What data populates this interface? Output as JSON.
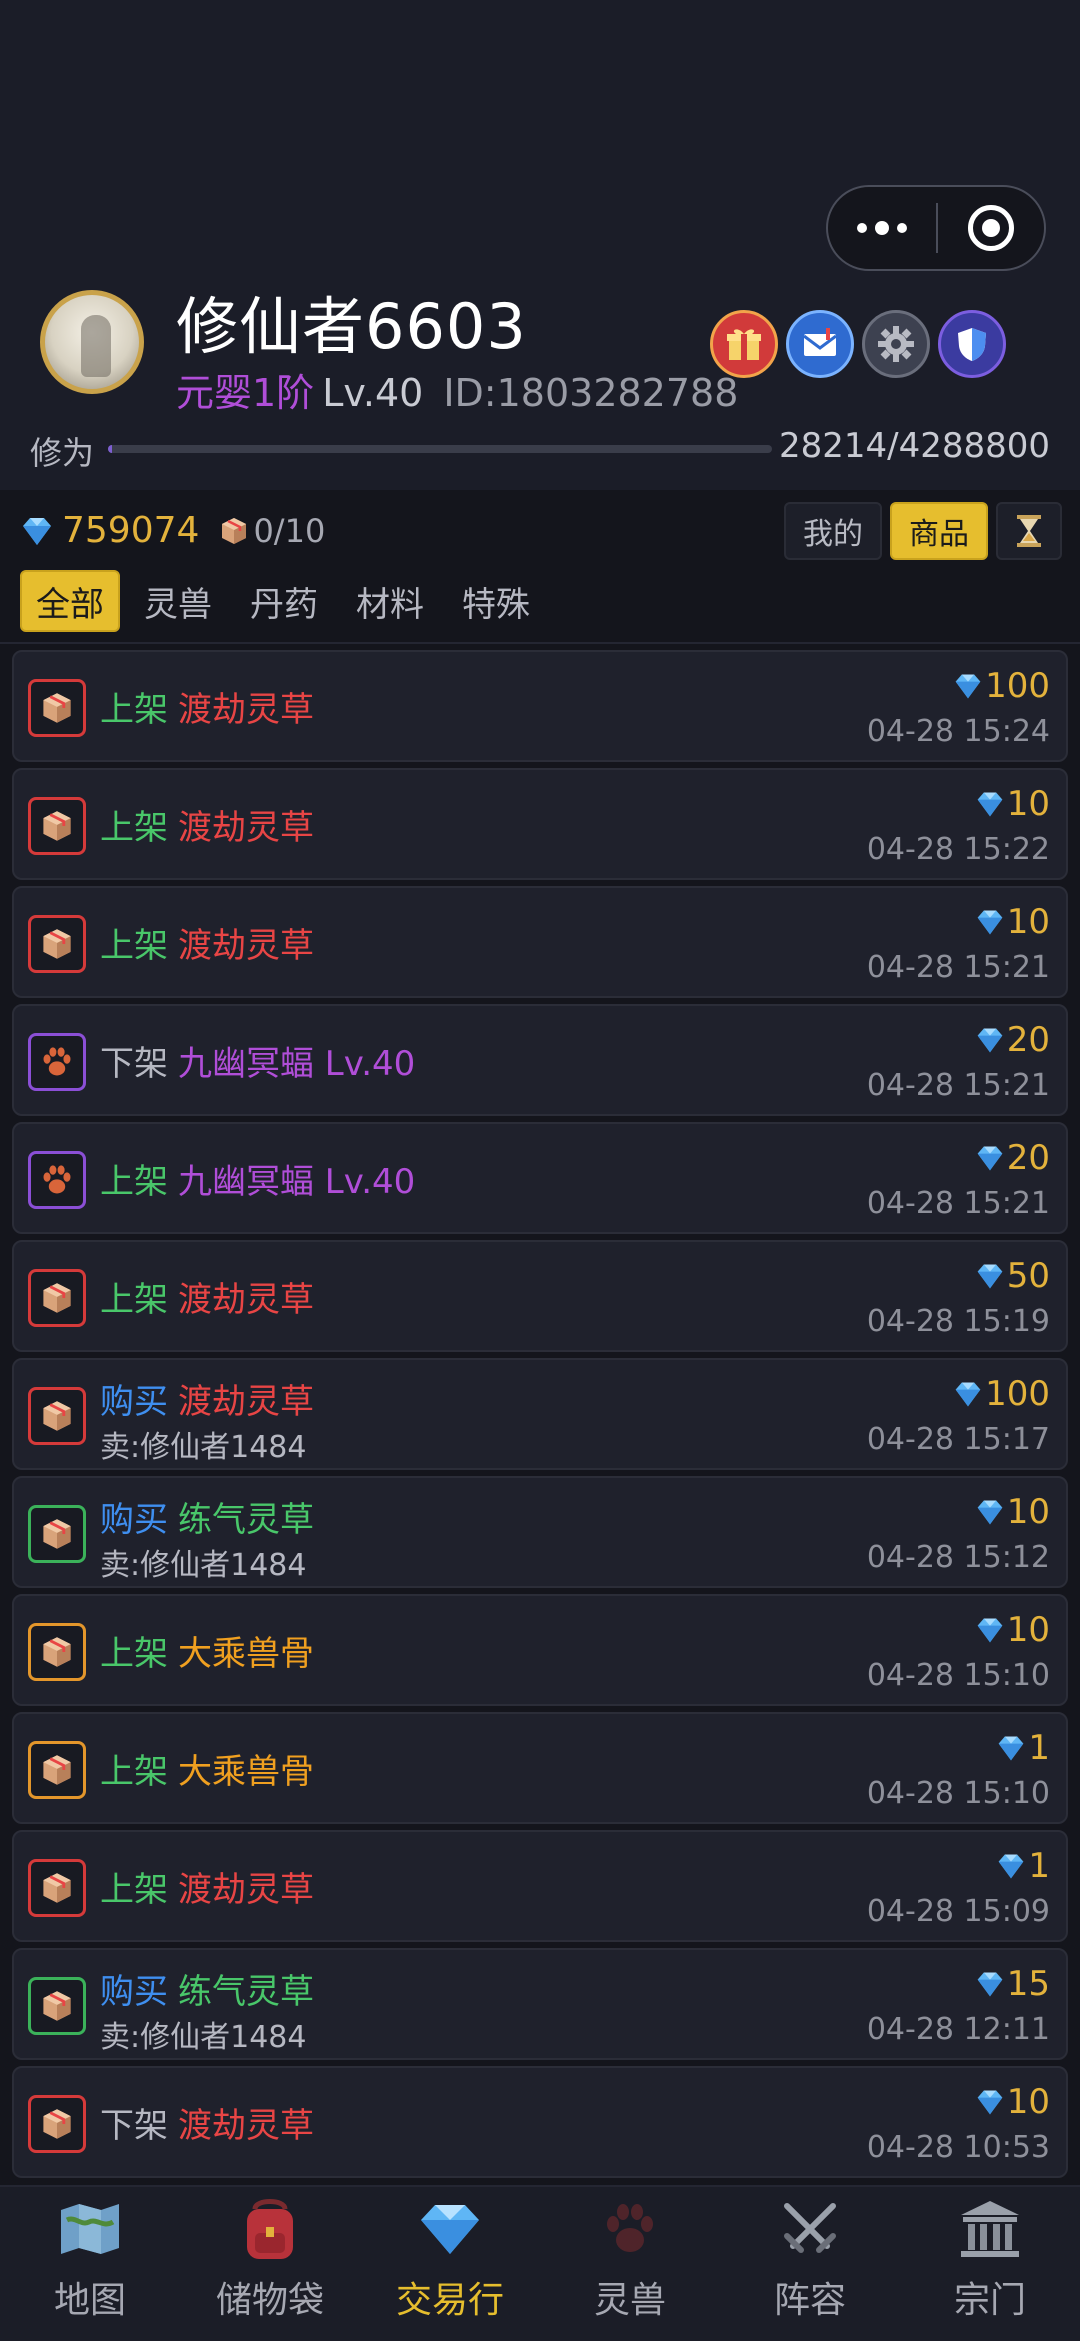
{
  "header": {
    "player_name": "修仙者6603",
    "realm": "元婴1阶",
    "level": "Lv.40",
    "player_id": "ID:1803282788",
    "cultivation_label": "修为",
    "cultivation_value": "28214/4288800",
    "cultivation_progress": 0.0066,
    "icons": [
      "gift-icon",
      "mail-icon",
      "gear-icon",
      "shield-icon"
    ]
  },
  "resources": {
    "gems": "759074",
    "capacity": "0/10"
  },
  "view_toggle": {
    "mine": "我的",
    "goods": "商品",
    "history_icon": "hourglass-icon"
  },
  "tabs": [
    "全部",
    "灵兽",
    "丹药",
    "材料",
    "特殊"
  ],
  "records": [
    {
      "action": "上架",
      "action_type": "up",
      "item": "渡劫灵草",
      "color": "red",
      "icon": "box-icon",
      "price": "100",
      "time": "04-28 15:24",
      "seller": ""
    },
    {
      "action": "上架",
      "action_type": "up",
      "item": "渡劫灵草",
      "color": "red",
      "icon": "box-icon",
      "price": "10",
      "time": "04-28 15:22",
      "seller": ""
    },
    {
      "action": "上架",
      "action_type": "up",
      "item": "渡劫灵草",
      "color": "red",
      "icon": "box-icon",
      "price": "10",
      "time": "04-28 15:21",
      "seller": ""
    },
    {
      "action": "下架",
      "action_type": "down",
      "item": "九幽冥蝠 Lv.40",
      "color": "purple",
      "icon": "paw-icon",
      "price": "20",
      "time": "04-28 15:21",
      "seller": ""
    },
    {
      "action": "上架",
      "action_type": "up",
      "item": "九幽冥蝠 Lv.40",
      "color": "purple",
      "icon": "paw-icon",
      "price": "20",
      "time": "04-28 15:21",
      "seller": ""
    },
    {
      "action": "上架",
      "action_type": "up",
      "item": "渡劫灵草",
      "color": "red",
      "icon": "box-icon",
      "price": "50",
      "time": "04-28 15:19",
      "seller": ""
    },
    {
      "action": "购买",
      "action_type": "buy",
      "item": "渡劫灵草",
      "color": "red",
      "icon": "box-icon",
      "price": "100",
      "time": "04-28 15:17",
      "seller": "卖:修仙者1484"
    },
    {
      "action": "购买",
      "action_type": "buy",
      "item": "练气灵草",
      "color": "green",
      "icon": "box-icon",
      "price": "10",
      "time": "04-28 15:12",
      "seller": "卖:修仙者1484"
    },
    {
      "action": "上架",
      "action_type": "up",
      "item": "大乘兽骨",
      "color": "orange",
      "icon": "box-icon",
      "price": "10",
      "time": "04-28 15:10",
      "seller": ""
    },
    {
      "action": "上架",
      "action_type": "up",
      "item": "大乘兽骨",
      "color": "orange",
      "icon": "box-icon",
      "price": "1",
      "time": "04-28 15:10",
      "seller": ""
    },
    {
      "action": "上架",
      "action_type": "up",
      "item": "渡劫灵草",
      "color": "red",
      "icon": "box-icon",
      "price": "1",
      "time": "04-28 15:09",
      "seller": ""
    },
    {
      "action": "购买",
      "action_type": "buy",
      "item": "练气灵草",
      "color": "green",
      "icon": "box-icon",
      "price": "15",
      "time": "04-28 12:11",
      "seller": "卖:修仙者1484"
    },
    {
      "action": "下架",
      "action_type": "down",
      "item": "渡劫灵草",
      "color": "red",
      "icon": "box-icon",
      "price": "10",
      "time": "04-28 10:53",
      "seller": ""
    }
  ],
  "nav": [
    {
      "label": "地图",
      "icon": "map-icon",
      "active": false
    },
    {
      "label": "储物袋",
      "icon": "backpack-icon",
      "active": false
    },
    {
      "label": "交易行",
      "icon": "diamond-icon",
      "active": true
    },
    {
      "label": "灵兽",
      "icon": "paw-icon",
      "active": false
    },
    {
      "label": "阵容",
      "icon": "crossed-swords-icon",
      "active": false
    },
    {
      "label": "宗门",
      "icon": "temple-icon",
      "active": false
    }
  ],
  "colors": {
    "accent": "#e6be2e",
    "gem": "#e3b23c",
    "up": "#49c76a",
    "buy": "#3f8ff0",
    "rarity_red": "#e84545",
    "rarity_purple": "#b04ed8",
    "rarity_orange": "#f0a020",
    "rarity_green": "#49c76a"
  }
}
